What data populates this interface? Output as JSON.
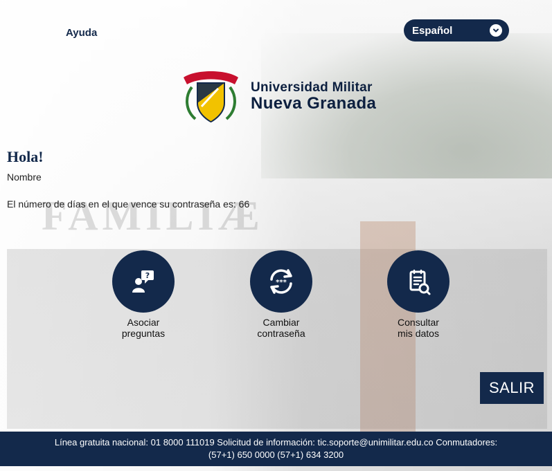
{
  "header": {
    "help_label": "Ayuda",
    "language": {
      "selected": "Español"
    }
  },
  "logo": {
    "line1": "Universidad Militar",
    "line2": "Nueva Granada"
  },
  "greeting": {
    "title": "Hola!",
    "name": "Nombre",
    "password_message": "El número de días en el que vence su contraseña es:",
    "days": "66"
  },
  "actions": [
    {
      "line1": "Asociar",
      "line2": "preguntas",
      "icon": "question-person-icon"
    },
    {
      "line1": "Cambiar",
      "line2": "contraseña",
      "icon": "password-refresh-icon"
    },
    {
      "line1": "Consultar",
      "line2": "mis datos",
      "icon": "document-search-icon"
    }
  ],
  "logout_label": "SALIR",
  "footer": {
    "line1": "Línea gratuita nacional: 01 8000 111019 Solicitud de información: tic.soporte@unimilitar.edu.co Conmutadores:",
    "line2": "(57+1) 650 0000 (57+1) 634 3200"
  },
  "colors": {
    "brand_navy": "#13294b",
    "accent_gold": "#f2c200",
    "accent_red": "#c8102e"
  }
}
